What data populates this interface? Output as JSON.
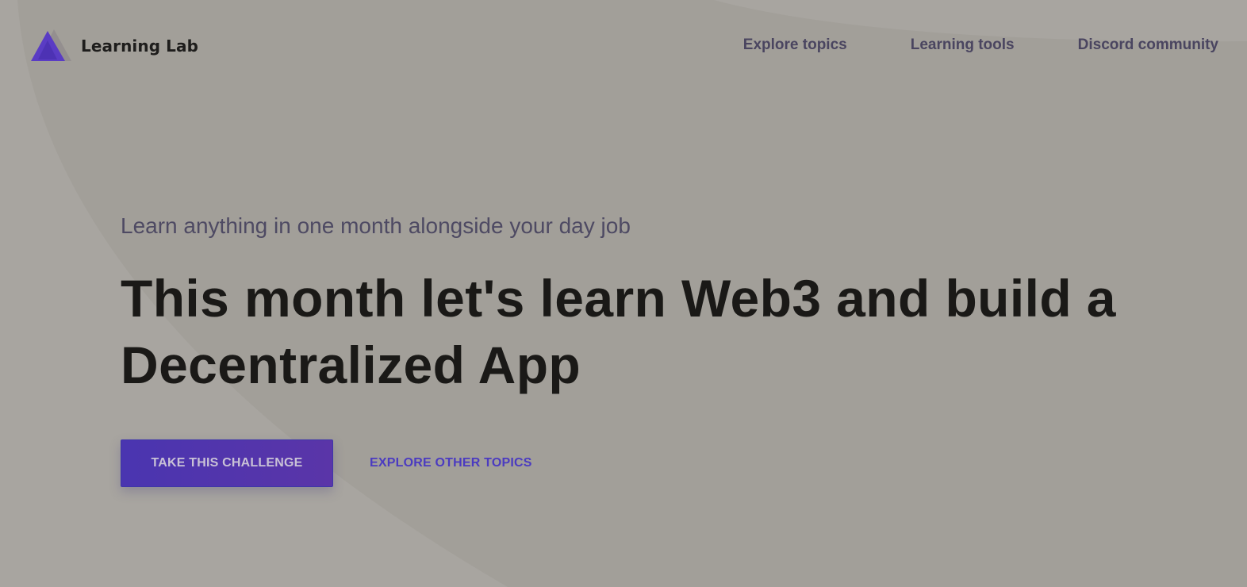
{
  "brand": {
    "name": "Learning Lab",
    "logo_icon": "triangle-logo-icon"
  },
  "nav": {
    "items": [
      {
        "label": "Explore topics"
      },
      {
        "label": "Learning tools"
      },
      {
        "label": "Discord community"
      }
    ]
  },
  "hero": {
    "eyebrow": "Learn anything in one month alongside your day job",
    "headline": "This month let's learn Web3 and build a Decentralized App",
    "primary_cta": "TAKE THIS CHALLENGE",
    "secondary_cta": "EXPLORE OTHER TOPICS"
  },
  "colors": {
    "background": "#a8a5a0",
    "background_shape": "#a29f99",
    "accent": "#4a35b0",
    "nav_text": "#4a4560",
    "headline_text": "#1a1917"
  }
}
